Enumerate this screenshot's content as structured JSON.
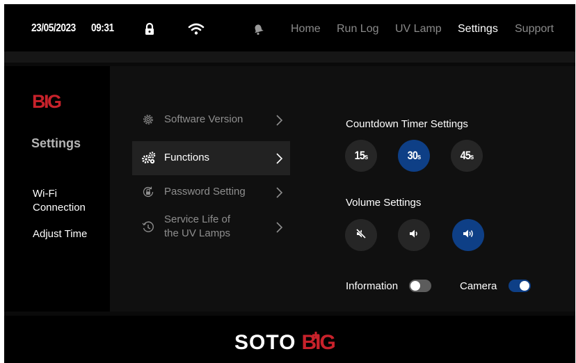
{
  "status_bar": {
    "date": "23/05/2023",
    "time": "09:31",
    "icons": [
      "lock-icon",
      "wifi-icon",
      "bell-icon"
    ]
  },
  "nav": {
    "items": [
      "Home",
      "Run Log",
      "UV Lamp",
      "Settings",
      "Support"
    ],
    "active": "Settings"
  },
  "left_panel": {
    "brand": "BIG",
    "title": "Settings",
    "items": [
      "Wi-Fi\nConnection",
      "Adjust Time"
    ]
  },
  "settings_menu": {
    "items": [
      {
        "label": "Software Version",
        "icon": "gear-outline-icon",
        "active": false
      },
      {
        "label": "Functions",
        "icon": "gears-icon",
        "active": true
      },
      {
        "label": "Password Setting",
        "icon": "lock-circle-icon",
        "active": false
      },
      {
        "label": "Service Life of\nthe UV Lamps",
        "icon": "clock-history-icon",
        "active": false
      }
    ]
  },
  "countdown": {
    "title": "Countdown Timer Settings",
    "options": [
      {
        "value": "15",
        "unit": "s"
      },
      {
        "value": "30",
        "unit": "s"
      },
      {
        "value": "45",
        "unit": "s"
      }
    ],
    "selected": "30"
  },
  "volume": {
    "title": "Volume Settings",
    "options": [
      "volume-mute-icon",
      "volume-low-icon",
      "volume-high-icon"
    ],
    "selected": "volume-high-icon"
  },
  "toggles": {
    "information": {
      "label": "Information",
      "on": false
    },
    "camera": {
      "label": "Camera",
      "on": true
    }
  },
  "footer": {
    "logo_left": "SOTO",
    "logo_right": "BIG"
  },
  "colors": {
    "accent_blue": "#0e3f86",
    "brand_red": "#c8222b",
    "background": "#000000",
    "panel": "#101010"
  }
}
